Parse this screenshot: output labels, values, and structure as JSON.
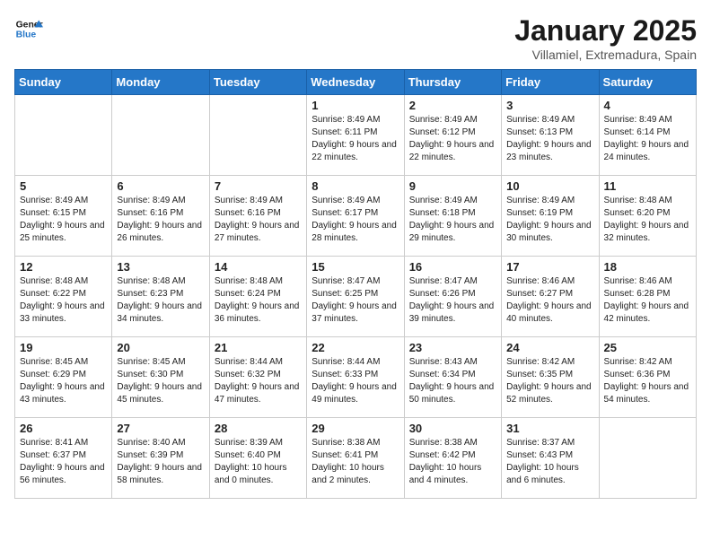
{
  "logo": {
    "line1": "General",
    "line2": "Blue"
  },
  "title": "January 2025",
  "subtitle": "Villamiel, Extremadura, Spain",
  "days_header": [
    "Sunday",
    "Monday",
    "Tuesday",
    "Wednesday",
    "Thursday",
    "Friday",
    "Saturday"
  ],
  "weeks": [
    [
      {
        "day": "",
        "info": ""
      },
      {
        "day": "",
        "info": ""
      },
      {
        "day": "",
        "info": ""
      },
      {
        "day": "1",
        "info": "Sunrise: 8:49 AM\nSunset: 6:11 PM\nDaylight: 9 hours\nand 22 minutes."
      },
      {
        "day": "2",
        "info": "Sunrise: 8:49 AM\nSunset: 6:12 PM\nDaylight: 9 hours\nand 22 minutes."
      },
      {
        "day": "3",
        "info": "Sunrise: 8:49 AM\nSunset: 6:13 PM\nDaylight: 9 hours\nand 23 minutes."
      },
      {
        "day": "4",
        "info": "Sunrise: 8:49 AM\nSunset: 6:14 PM\nDaylight: 9 hours\nand 24 minutes."
      }
    ],
    [
      {
        "day": "5",
        "info": "Sunrise: 8:49 AM\nSunset: 6:15 PM\nDaylight: 9 hours\nand 25 minutes."
      },
      {
        "day": "6",
        "info": "Sunrise: 8:49 AM\nSunset: 6:16 PM\nDaylight: 9 hours\nand 26 minutes."
      },
      {
        "day": "7",
        "info": "Sunrise: 8:49 AM\nSunset: 6:16 PM\nDaylight: 9 hours\nand 27 minutes."
      },
      {
        "day": "8",
        "info": "Sunrise: 8:49 AM\nSunset: 6:17 PM\nDaylight: 9 hours\nand 28 minutes."
      },
      {
        "day": "9",
        "info": "Sunrise: 8:49 AM\nSunset: 6:18 PM\nDaylight: 9 hours\nand 29 minutes."
      },
      {
        "day": "10",
        "info": "Sunrise: 8:49 AM\nSunset: 6:19 PM\nDaylight: 9 hours\nand 30 minutes."
      },
      {
        "day": "11",
        "info": "Sunrise: 8:48 AM\nSunset: 6:20 PM\nDaylight: 9 hours\nand 32 minutes."
      }
    ],
    [
      {
        "day": "12",
        "info": "Sunrise: 8:48 AM\nSunset: 6:22 PM\nDaylight: 9 hours\nand 33 minutes."
      },
      {
        "day": "13",
        "info": "Sunrise: 8:48 AM\nSunset: 6:23 PM\nDaylight: 9 hours\nand 34 minutes."
      },
      {
        "day": "14",
        "info": "Sunrise: 8:48 AM\nSunset: 6:24 PM\nDaylight: 9 hours\nand 36 minutes."
      },
      {
        "day": "15",
        "info": "Sunrise: 8:47 AM\nSunset: 6:25 PM\nDaylight: 9 hours\nand 37 minutes."
      },
      {
        "day": "16",
        "info": "Sunrise: 8:47 AM\nSunset: 6:26 PM\nDaylight: 9 hours\nand 39 minutes."
      },
      {
        "day": "17",
        "info": "Sunrise: 8:46 AM\nSunset: 6:27 PM\nDaylight: 9 hours\nand 40 minutes."
      },
      {
        "day": "18",
        "info": "Sunrise: 8:46 AM\nSunset: 6:28 PM\nDaylight: 9 hours\nand 42 minutes."
      }
    ],
    [
      {
        "day": "19",
        "info": "Sunrise: 8:45 AM\nSunset: 6:29 PM\nDaylight: 9 hours\nand 43 minutes."
      },
      {
        "day": "20",
        "info": "Sunrise: 8:45 AM\nSunset: 6:30 PM\nDaylight: 9 hours\nand 45 minutes."
      },
      {
        "day": "21",
        "info": "Sunrise: 8:44 AM\nSunset: 6:32 PM\nDaylight: 9 hours\nand 47 minutes."
      },
      {
        "day": "22",
        "info": "Sunrise: 8:44 AM\nSunset: 6:33 PM\nDaylight: 9 hours\nand 49 minutes."
      },
      {
        "day": "23",
        "info": "Sunrise: 8:43 AM\nSunset: 6:34 PM\nDaylight: 9 hours\nand 50 minutes."
      },
      {
        "day": "24",
        "info": "Sunrise: 8:42 AM\nSunset: 6:35 PM\nDaylight: 9 hours\nand 52 minutes."
      },
      {
        "day": "25",
        "info": "Sunrise: 8:42 AM\nSunset: 6:36 PM\nDaylight: 9 hours\nand 54 minutes."
      }
    ],
    [
      {
        "day": "26",
        "info": "Sunrise: 8:41 AM\nSunset: 6:37 PM\nDaylight: 9 hours\nand 56 minutes."
      },
      {
        "day": "27",
        "info": "Sunrise: 8:40 AM\nSunset: 6:39 PM\nDaylight: 9 hours\nand 58 minutes."
      },
      {
        "day": "28",
        "info": "Sunrise: 8:39 AM\nSunset: 6:40 PM\nDaylight: 10 hours\nand 0 minutes."
      },
      {
        "day": "29",
        "info": "Sunrise: 8:38 AM\nSunset: 6:41 PM\nDaylight: 10 hours\nand 2 minutes."
      },
      {
        "day": "30",
        "info": "Sunrise: 8:38 AM\nSunset: 6:42 PM\nDaylight: 10 hours\nand 4 minutes."
      },
      {
        "day": "31",
        "info": "Sunrise: 8:37 AM\nSunset: 6:43 PM\nDaylight: 10 hours\nand 6 minutes."
      },
      {
        "day": "",
        "info": ""
      }
    ]
  ]
}
